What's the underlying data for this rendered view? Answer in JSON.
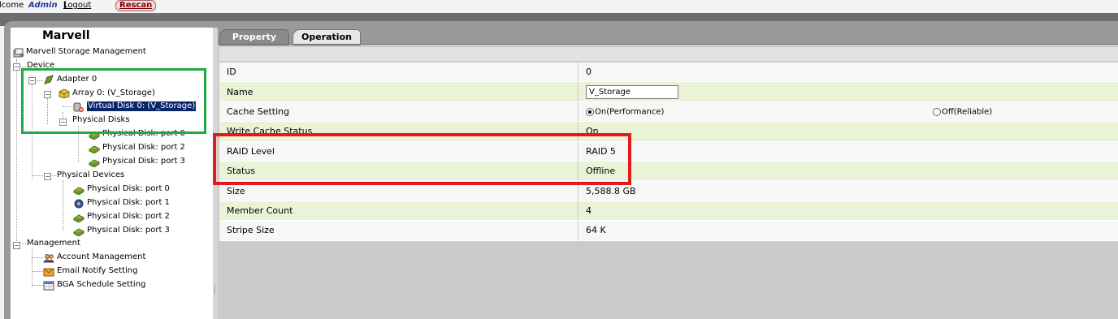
{
  "header": {
    "welcome": "lcome",
    "user": "Admin",
    "logout": "Logout",
    "bracket_open": "[",
    "bracket_close": "]",
    "rescan": "Rescan"
  },
  "sidebar": {
    "title": "Marvell",
    "tree": {
      "root": "Marvell Storage Management",
      "device": "Device",
      "adapter": "Adapter 0",
      "array": "Array 0: (V_Storage)",
      "virtual_disk": "Virtual Disk 0: (V_Storage)",
      "physical_disks_group": "Physical Disks",
      "array_disks": [
        "Physical Disk: port 0",
        "Physical Disk: port 2",
        "Physical Disk: port 3"
      ],
      "physical_devices": "Physical Devices",
      "devices": [
        "Physical Disk: port 0",
        "Physical Disk: port 1",
        "Physical Disk: port 2",
        "Physical Disk: port 3"
      ],
      "management": "Management",
      "management_items": [
        "Account Management",
        "Email Notify Setting",
        "BGA Schedule Setting"
      ]
    }
  },
  "tabs": {
    "property": "Property",
    "operation": "Operation"
  },
  "properties": {
    "id": {
      "label": "ID",
      "value": "0"
    },
    "name": {
      "label": "Name",
      "value": "V_Storage"
    },
    "cache": {
      "label": "Cache Setting",
      "option_on": "On(Performance)",
      "option_off": "Off(Reliable)",
      "selected": "on"
    },
    "write_cache": {
      "label": "Write Cache Status",
      "value": "On"
    },
    "raid": {
      "label": "RAID Level",
      "value": "RAID 5"
    },
    "status": {
      "label": "Status",
      "value": "Offline"
    },
    "size": {
      "label": "Size",
      "value": "5,588.8 GB"
    },
    "member_count": {
      "label": "Member Count",
      "value": "4"
    },
    "stripe": {
      "label": "Stripe Size",
      "value": "64 K"
    }
  },
  "colors": {
    "highlight_green": "#22a844",
    "highlight_red": "#e01c1c",
    "row_alt": "#eaf3d7",
    "selection": "#0a246a"
  }
}
